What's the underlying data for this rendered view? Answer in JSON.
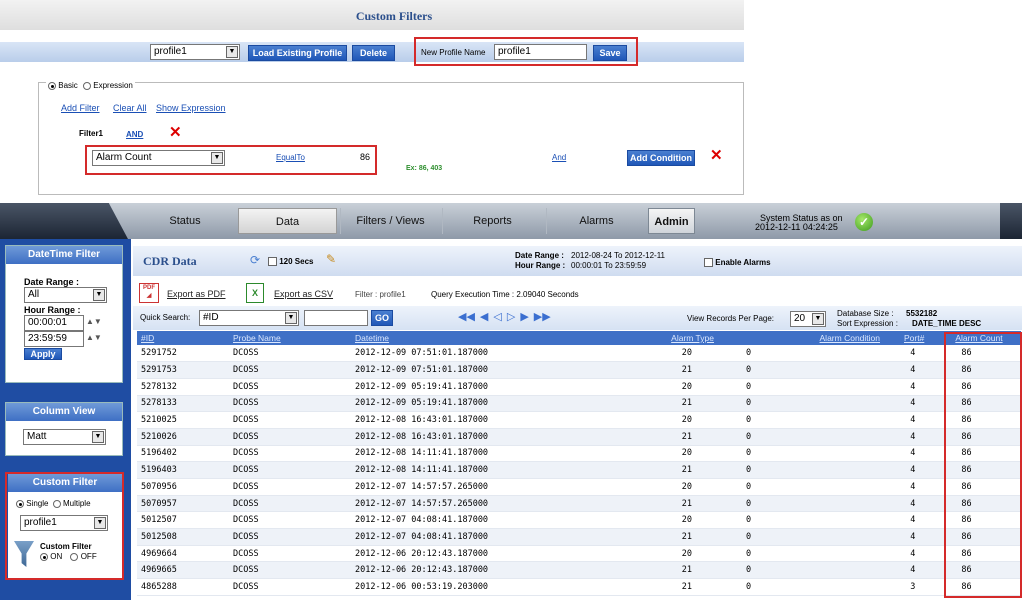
{
  "custom_filters_panel": {
    "title": "Custom Filters",
    "profile_select": "profile1",
    "load_button": "Load Existing Profile",
    "delete_button": "Delete",
    "new_profile_label": "New Profile Name",
    "new_profile_value": "profile1",
    "save_button": "Save",
    "mode_basic": "Basic",
    "mode_expression": "Expression",
    "add_filter": "Add Filter",
    "clear_all": "Clear All",
    "show_expression": "Show Expression",
    "filter_label": "Filter1",
    "filter_and": "AND",
    "condition_field": "Alarm Count",
    "condition_operator": "EqualTo",
    "condition_value": "86",
    "condition_example": "Ex: 86, 403",
    "condition_and": "And",
    "add_condition_button": "Add Condition"
  },
  "top_nav": {
    "tabs": [
      "Status",
      "Data",
      "Filters / Views",
      "Reports",
      "Alarms",
      "Admin"
    ],
    "system_status_label": "System Status as on",
    "system_status_time": "2012-12-11 04:24:25"
  },
  "sidebar": {
    "datetime_title": "DateTime Filter",
    "date_range_label": "Date Range :",
    "date_range_value": "All",
    "hour_range_label": "Hour Range :",
    "hour_from": "00:00:01",
    "hour_to": "23:59:59",
    "apply_button": "Apply",
    "column_view_title": "Column View",
    "column_view_value": "Matt",
    "custom_filter_title": "Custom Filter",
    "single_label": "Single",
    "multiple_label": "Multiple",
    "profile_value": "profile1",
    "custom_filter_label": "Custom Filter",
    "on_label": "ON",
    "off_label": "OFF"
  },
  "cdr": {
    "title": "CDR Data",
    "refresh_label": "120 Secs",
    "date_range_label": "Date Range :",
    "date_range_value": "2012-08-24 To 2012-12-11",
    "hour_range_label": "Hour Range :",
    "hour_range_value": "00:00:01 To 23:59:59",
    "enable_alarms": "Enable Alarms",
    "export_pdf": "Export as PDF",
    "export_csv": "Export as CSV",
    "filter_text": "Filter : profile1",
    "query_time": "Query Execution Time : 2.09040 Seconds",
    "quick_search_label": "Quick Search:",
    "quick_search_field": "#ID",
    "go_button": "GO",
    "view_records_label": "View Records Per Page:",
    "view_records_value": "20",
    "db_size_label": "Database Size :",
    "db_size_value": "5532182",
    "sort_expr_label": "Sort Expression :",
    "sort_expr_value": "DATE_TIME DESC"
  },
  "table": {
    "headers": [
      "#ID",
      "Probe Name",
      "Datetime",
      "Alarm Type",
      "Alarm Condition",
      "Port#",
      "Alarm Count"
    ],
    "rows": [
      [
        "5291752",
        "DCOSS",
        "2012-12-09 07:51:01.187000",
        "20",
        "0",
        "4",
        "86"
      ],
      [
        "5291753",
        "DCOSS",
        "2012-12-09 07:51:01.187000",
        "21",
        "0",
        "4",
        "86"
      ],
      [
        "5278132",
        "DCOSS",
        "2012-12-09 05:19:41.187000",
        "20",
        "0",
        "4",
        "86"
      ],
      [
        "5278133",
        "DCOSS",
        "2012-12-09 05:19:41.187000",
        "21",
        "0",
        "4",
        "86"
      ],
      [
        "5210025",
        "DCOSS",
        "2012-12-08 16:43:01.187000",
        "20",
        "0",
        "4",
        "86"
      ],
      [
        "5210026",
        "DCOSS",
        "2012-12-08 16:43:01.187000",
        "21",
        "0",
        "4",
        "86"
      ],
      [
        "5196402",
        "DCOSS",
        "2012-12-08 14:11:41.187000",
        "20",
        "0",
        "4",
        "86"
      ],
      [
        "5196403",
        "DCOSS",
        "2012-12-08 14:11:41.187000",
        "21",
        "0",
        "4",
        "86"
      ],
      [
        "5070956",
        "DCOSS",
        "2012-12-07 14:57:57.265000",
        "20",
        "0",
        "4",
        "86"
      ],
      [
        "5070957",
        "DCOSS",
        "2012-12-07 14:57:57.265000",
        "21",
        "0",
        "4",
        "86"
      ],
      [
        "5012507",
        "DCOSS",
        "2012-12-07 04:08:41.187000",
        "20",
        "0",
        "4",
        "86"
      ],
      [
        "5012508",
        "DCOSS",
        "2012-12-07 04:08:41.187000",
        "21",
        "0",
        "4",
        "86"
      ],
      [
        "4969664",
        "DCOSS",
        "2012-12-06 20:12:43.187000",
        "20",
        "0",
        "4",
        "86"
      ],
      [
        "4969665",
        "DCOSS",
        "2012-12-06 20:12:43.187000",
        "21",
        "0",
        "4",
        "86"
      ],
      [
        "4865288",
        "DCOSS",
        "2012-12-06 00:53:19.203000",
        "21",
        "0",
        "3",
        "86"
      ]
    ]
  }
}
